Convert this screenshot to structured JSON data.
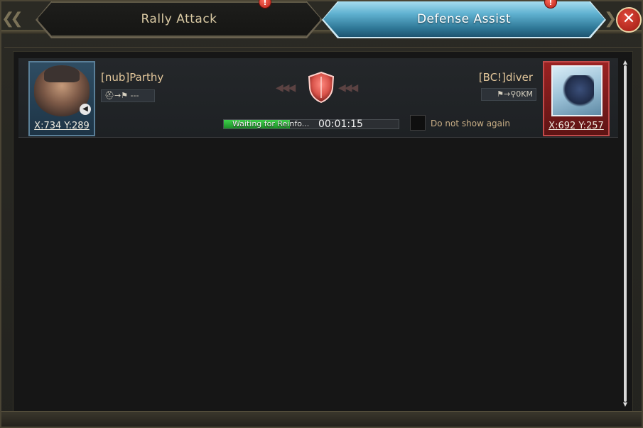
{
  "tabs": [
    {
      "label": "Rally Attack",
      "active": false,
      "notification": "!"
    },
    {
      "label": "Defense Assist",
      "active": true,
      "notification": "!"
    }
  ],
  "close_label": "✕",
  "entry": {
    "left": {
      "name": "[nub]Parthy",
      "coords": "X:734 Y:289",
      "route": "⛑→⚑ ---"
    },
    "right": {
      "name": "[BC!]diver",
      "coords": "X:692 Y:257",
      "route": "⚑→⚲0KM"
    },
    "status": {
      "label": "Waiting for Reinfo...",
      "progress": 0.38,
      "timer": "00:01:15"
    },
    "checkbox_label": "Do not show again"
  },
  "colors": {
    "active_tab": "#5fb1d0",
    "progress": "#2fb63b",
    "shield": "#d9534a"
  }
}
